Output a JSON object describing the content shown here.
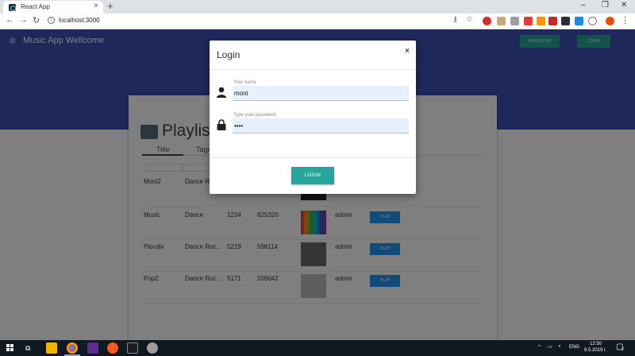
{
  "browser": {
    "tab_title": "React App",
    "tab_close": "×",
    "new_tab": "+",
    "url": "localhost:3000",
    "win_min": "–",
    "win_max": "❐",
    "win_close": "✕"
  },
  "app": {
    "title": "Music App Wellcome",
    "register_label": "REGISTER",
    "login_label": "LOGIN",
    "card_title": "Playlists",
    "tabs": [
      "Title",
      "Tags"
    ],
    "rows": [
      {
        "title": "Moni2",
        "tags": "Dance R",
        "n1": "",
        "n2": "",
        "owner": "",
        "play": ""
      },
      {
        "title": "Music",
        "tags": "Dance",
        "n1": "1234",
        "n2": "625320",
        "owner": "admin",
        "play": "PLAY"
      },
      {
        "title": "Plovdiv",
        "tags": "Dance Roc...",
        "n1": "5219",
        "n2": "596114",
        "owner": "admin",
        "play": "PLAY"
      },
      {
        "title": "Pop2",
        "tags": "Dance Roc...",
        "n1": "5171",
        "n2": "509042",
        "owner": "admin",
        "play": "PLAY"
      }
    ]
  },
  "modal": {
    "title": "Login",
    "close": "×",
    "name_label": "Your name",
    "name_value": "moni",
    "password_label": "Type your password",
    "password_value": "••••",
    "submit_label": "LOGIN"
  },
  "taskbar": {
    "lang": "ENG",
    "time": "12:50",
    "date": "9.5.2019 г.",
    "notif": "2"
  },
  "colors": {
    "primary": "#3f51b5",
    "accent": "#26a69a",
    "play": "#2196f3"
  }
}
